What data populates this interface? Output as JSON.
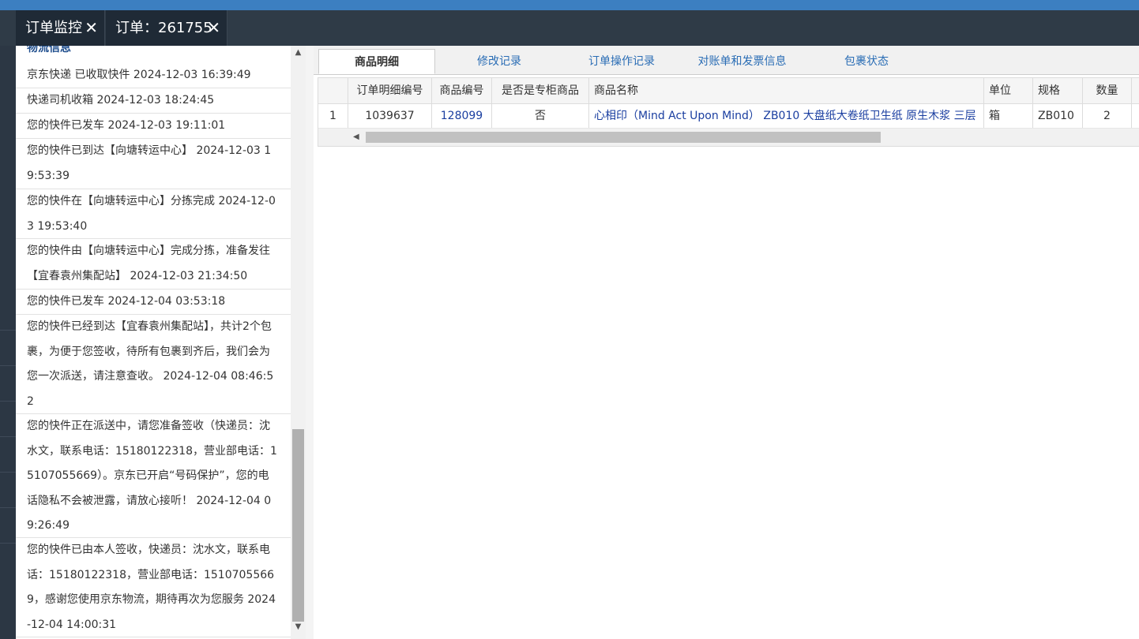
{
  "tabs": [
    {
      "label": "订单监控",
      "close": "✕"
    },
    {
      "label": "订单：261755",
      "close": "✕"
    }
  ],
  "logistics": {
    "header": "物流信息",
    "entries": [
      "京东快递 已收取快件 2024-12-03 16:39:49",
      "快递司机收箱 2024-12-03 18:24:45",
      "您的快件已发车 2024-12-03 19:11:01",
      "您的快件已到达【向塘转运中心】 2024-12-03 19:53:39",
      "您的快件在【向塘转运中心】分拣完成 2024-12-03 19:53:40",
      "您的快件由【向塘转运中心】完成分拣，准备发往【宜春袁州集配站】 2024-12-03 21:34:50",
      "您的快件已发车 2024-12-04 03:53:18",
      "您的快件已经到达【宜春袁州集配站】，共计2个包裹，为便于您签收，待所有包裹到齐后，我们会为您一次派送，请注意查收。 2024-12-04 08:46:52",
      "您的快件正在派送中，请您准备签收（快递员：沈水文，联系电话：15180122318，营业部电话：15107055669）。京东已开启“号码保护”，您的电话隐私不会被泄露，请放心接听！ 2024-12-04 09:26:49",
      "您的快件已由本人签收，快递员：沈水文，联系电话：15180122318，营业部电话：15107055669，感谢您使用京东物流，期待再次为您服务 2024-12-04 14:00:31"
    ]
  },
  "subtabs": [
    "商品明细",
    "修改记录",
    "订单操作记录",
    "对账单和发票信息",
    "包裹状态"
  ],
  "grid": {
    "columns": [
      "",
      "订单明细编号",
      "商品编号",
      "是否是专柜商品",
      "商品名称",
      "单位",
      "规格",
      "数量"
    ],
    "rows": [
      [
        "1",
        "1039637",
        "128099",
        "否",
        "心相印（Mind Act Upon Mind） ZB010 大盘纸大卷纸卫生纸 原生木浆 三层",
        "箱",
        "ZB010",
        "2"
      ]
    ]
  },
  "colors": {
    "topbar": "#3c7fc1",
    "tabbar": "#2f3b47",
    "link": "#1a3ea0"
  }
}
